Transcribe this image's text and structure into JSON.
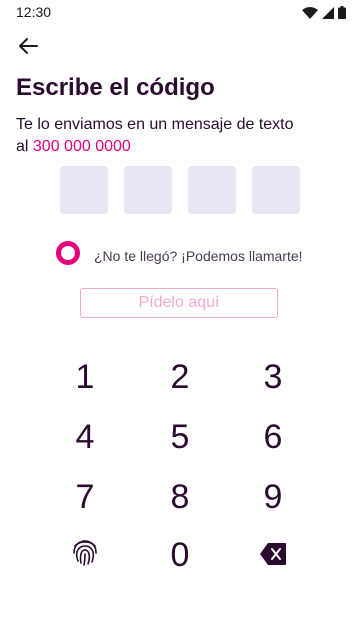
{
  "status_bar": {
    "time": "12:30"
  },
  "header": {
    "title": "Escribe el código"
  },
  "subtitle": {
    "line1": "Te lo enviamos en un mensaje de texto",
    "prefix": "al",
    "phone": "300 000 0000"
  },
  "callback": {
    "text": "¿No te llegó? ¡Podemos llamarte!"
  },
  "request_button": {
    "label": "Pídelo aquí"
  },
  "keypad": {
    "keys": [
      "1",
      "2",
      "3",
      "4",
      "5",
      "6",
      "7",
      "8",
      "9",
      "0"
    ]
  },
  "colors": {
    "accent": "#e4007c",
    "text": "#2a0a2e",
    "code_box": "#ebe6f5"
  }
}
